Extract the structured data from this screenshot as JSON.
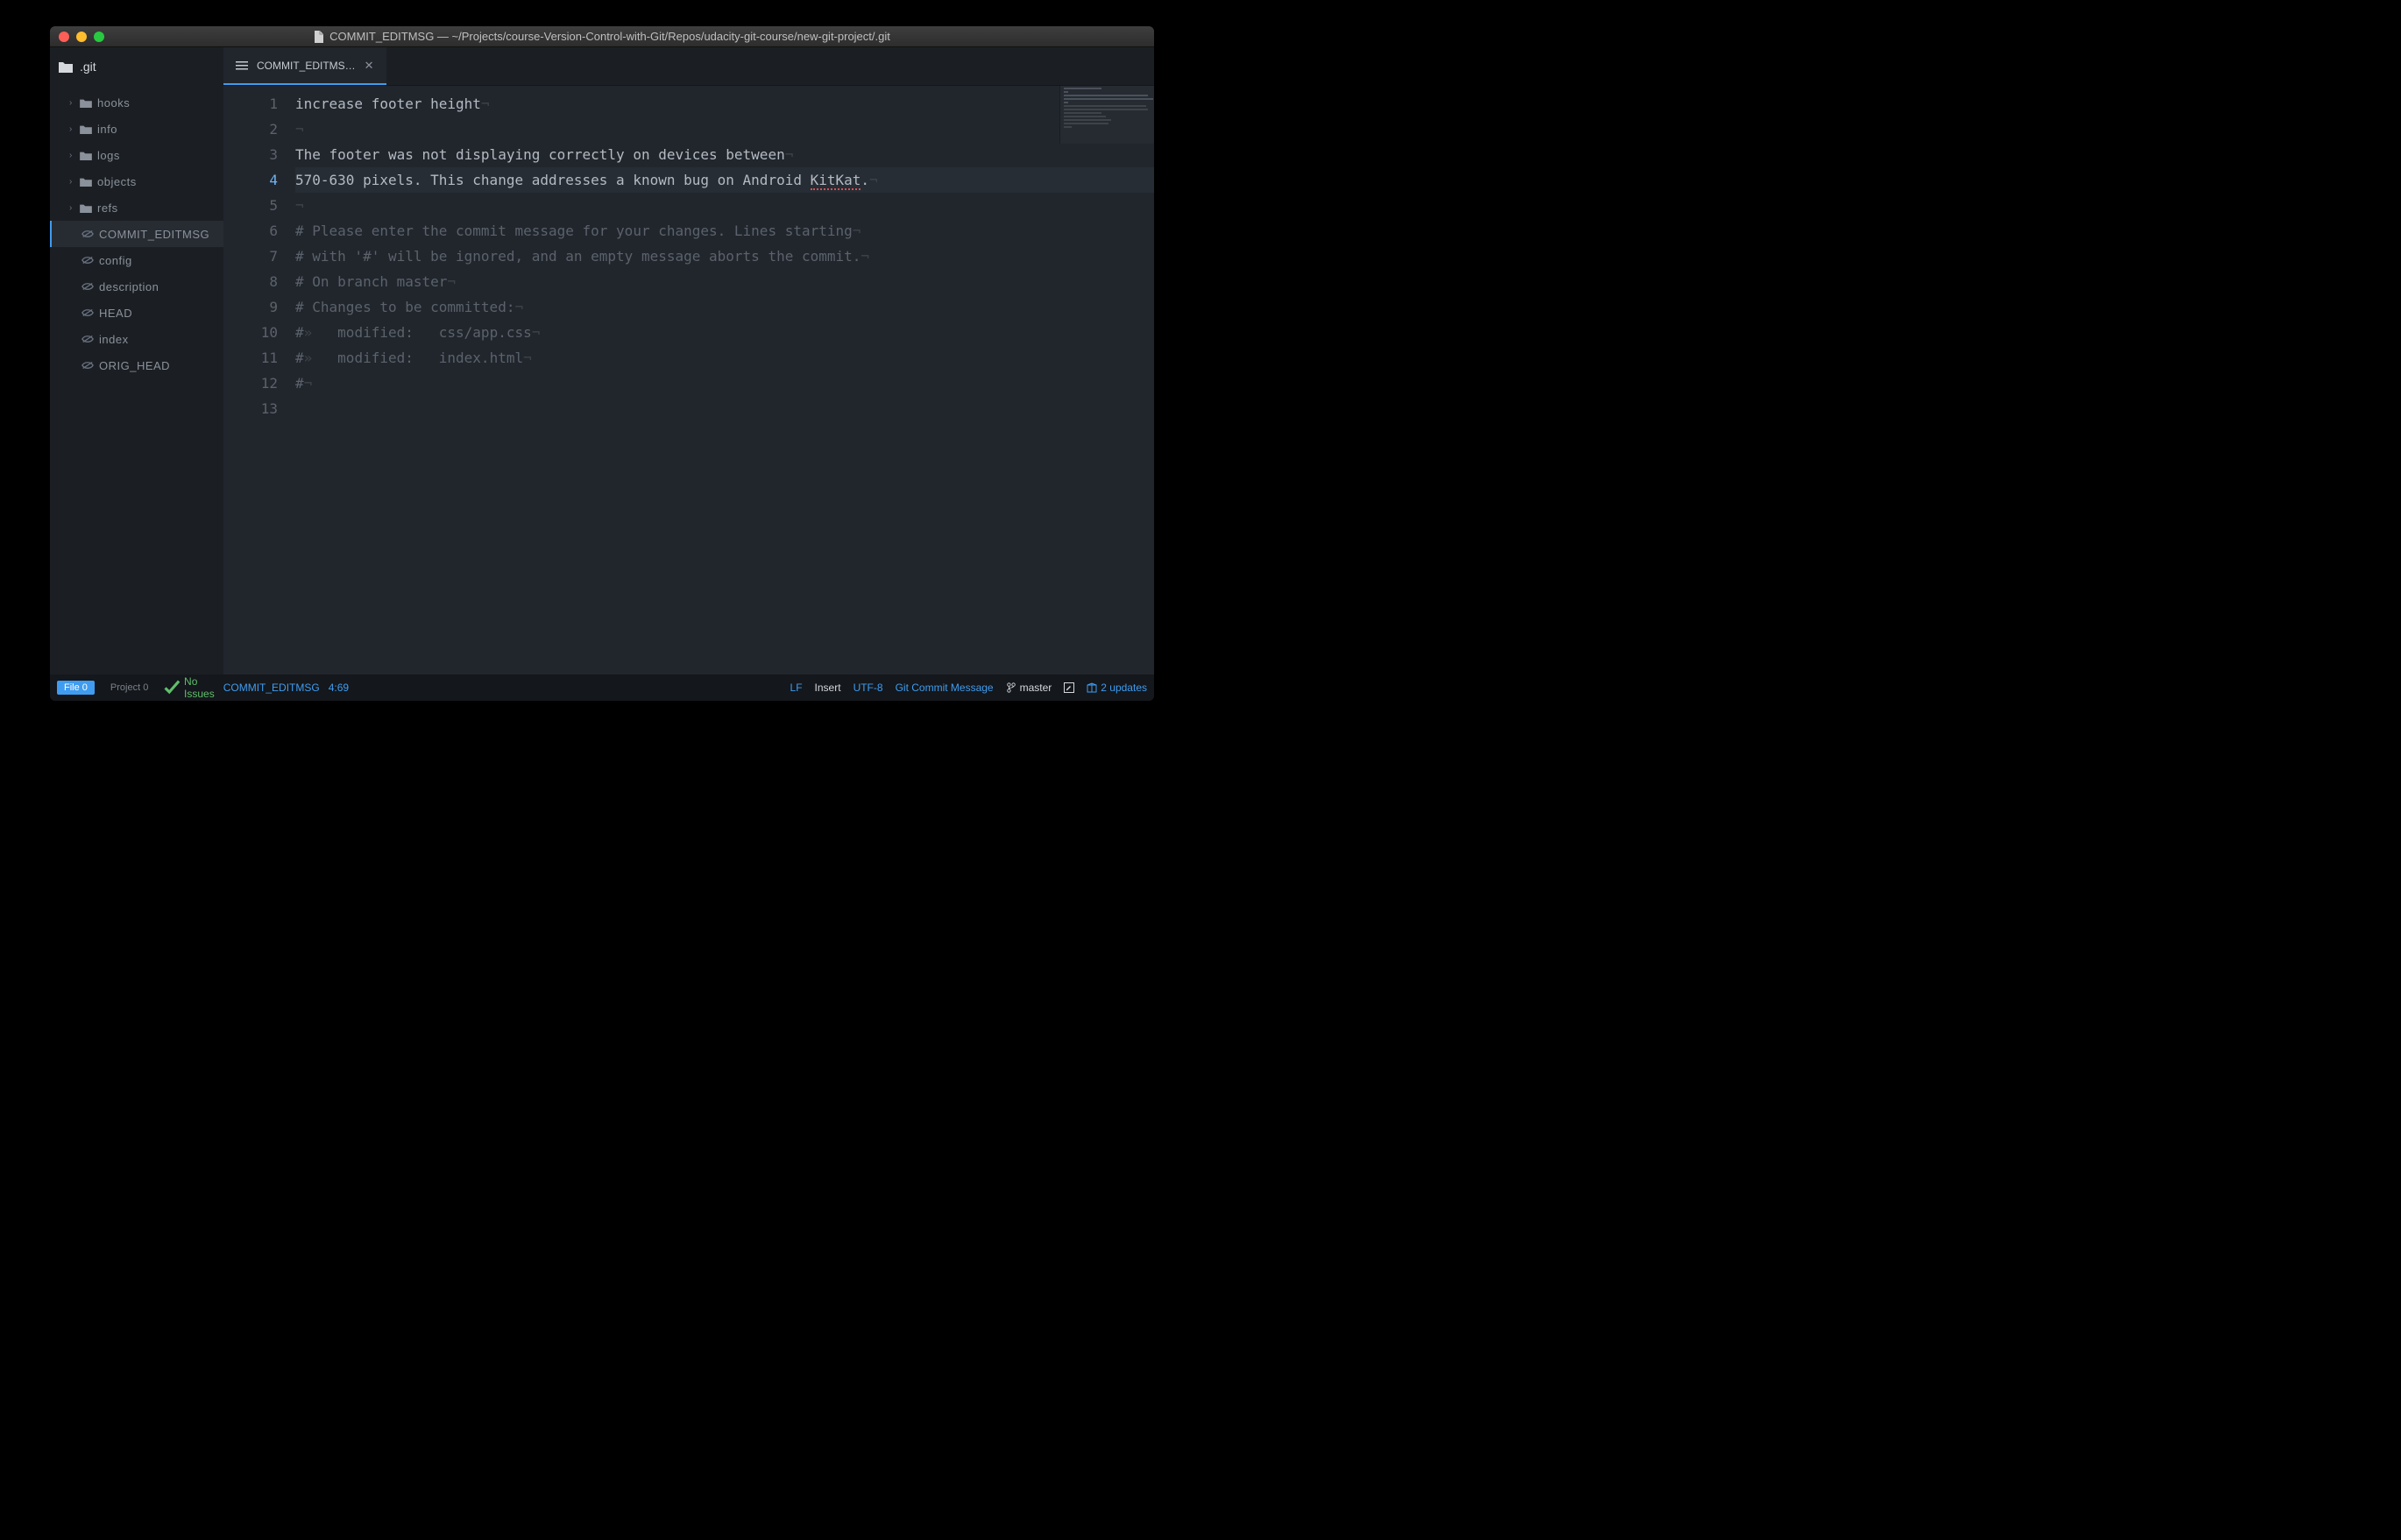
{
  "window": {
    "title": "COMMIT_EDITMSG — ~/Projects/course-Version-Control-with-Git/Repos/udacity-git-course/new-git-project/.git"
  },
  "sidebar": {
    "root": ".git",
    "folders": [
      {
        "label": "hooks"
      },
      {
        "label": "info"
      },
      {
        "label": "logs"
      },
      {
        "label": "objects"
      },
      {
        "label": "refs"
      }
    ],
    "files": [
      {
        "label": "COMMIT_EDITMSG",
        "active": true
      },
      {
        "label": "config"
      },
      {
        "label": "description"
      },
      {
        "label": "HEAD"
      },
      {
        "label": "index"
      },
      {
        "label": "ORIG_HEAD"
      }
    ]
  },
  "tabs": [
    {
      "label": "COMMIT_EDITMS…"
    }
  ],
  "editor": {
    "active_line": 4,
    "lines": [
      {
        "n": 1,
        "type": "text",
        "text": "increase footer height"
      },
      {
        "n": 2,
        "type": "blank",
        "text": ""
      },
      {
        "n": 3,
        "type": "text",
        "text": "The footer was not displaying correctly on devices between"
      },
      {
        "n": 4,
        "type": "text",
        "text": "570-630 pixels. This change addresses a known bug on Android ",
        "tail_spell": "KitKat",
        "tail_after": "."
      },
      {
        "n": 5,
        "type": "blank",
        "text": ""
      },
      {
        "n": 6,
        "type": "comment",
        "text": "# Please enter the commit message for your changes. Lines starting"
      },
      {
        "n": 7,
        "type": "comment",
        "text": "# with '#' will be ignored, and an empty message aborts the commit."
      },
      {
        "n": 8,
        "type": "comment",
        "text": "# On branch master"
      },
      {
        "n": 9,
        "type": "comment",
        "text": "# Changes to be committed:"
      },
      {
        "n": 10,
        "type": "comment-tab",
        "prefix": "#",
        "text": "modified:   css/app.css"
      },
      {
        "n": 11,
        "type": "comment-tab",
        "prefix": "#",
        "text": "modified:   index.html"
      },
      {
        "n": 12,
        "type": "comment",
        "text": "#"
      },
      {
        "n": 13,
        "type": "empty",
        "text": ""
      }
    ]
  },
  "status": {
    "file_label": "File",
    "file_count": "0",
    "project_label": "Project",
    "project_count": "0",
    "issues": "No Issues",
    "path": "COMMIT_EDITMSG",
    "position": "4:69",
    "eol": "LF",
    "mode": "Insert",
    "encoding": "UTF-8",
    "grammar": "Git Commit Message",
    "branch": "master",
    "updates": "2 updates"
  }
}
